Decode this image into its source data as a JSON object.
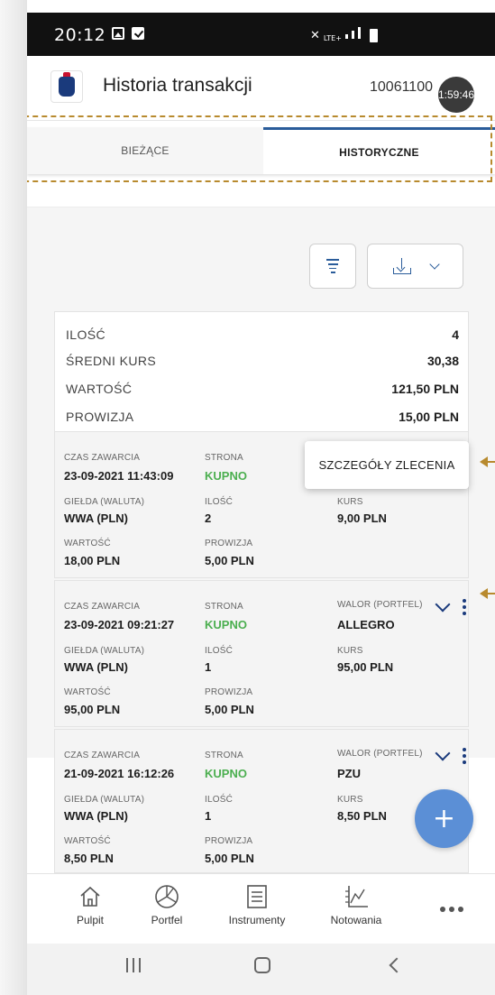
{
  "status_bar": {
    "time": "20:12",
    "network_label": "LTE+"
  },
  "app_bar": {
    "title": "Historia transakcji",
    "account_number": "10061100",
    "session_timer": "1:59:46"
  },
  "tabs": [
    {
      "label": "BIEŻĄCE",
      "active": false
    },
    {
      "label": "HISTORYCZNE",
      "active": true
    }
  ],
  "summary": {
    "rows": [
      {
        "label": "ILOŚĆ",
        "value": "4"
      },
      {
        "label": "ŚREDNI KURS",
        "value": "30,38"
      },
      {
        "label": "WARTOŚĆ",
        "value": "121,50 PLN"
      },
      {
        "label": "PROWIZJA",
        "value": "15,00 PLN"
      }
    ]
  },
  "field_labels": {
    "time": "CZAS ZAWARCIA",
    "side": "STRONA",
    "asset": "WALOR (PORTFEL)",
    "exchange": "GIEŁDA (WALUTA)",
    "quantity": "ILOŚĆ",
    "price": "KURS",
    "value": "WARTOŚĆ",
    "commission": "PROWIZJA"
  },
  "transactions": [
    {
      "time": "23-09-2021 11:43:09",
      "side": "KUPNO",
      "asset": "",
      "exchange": "WWA (PLN)",
      "quantity": "2",
      "price": "9,00 PLN",
      "value": "18,00 PLN",
      "commission": "5,00 PLN"
    },
    {
      "time": "23-09-2021 09:21:27",
      "side": "KUPNO",
      "asset": "ALLEGRO",
      "exchange": "WWA (PLN)",
      "quantity": "1",
      "price": "95,00 PLN",
      "value": "95,00 PLN",
      "commission": "5,00 PLN"
    },
    {
      "time": "21-09-2021 16:12:26",
      "side": "KUPNO",
      "asset": "PZU",
      "exchange": "WWA (PLN)",
      "quantity": "1",
      "price": "8,50 PLN",
      "value": "8,50 PLN",
      "commission": "5,00 PLN"
    }
  ],
  "popup_menu": {
    "item": "SZCZEGÓŁY ZLECENIA"
  },
  "fab": {
    "label": "+"
  },
  "bottom_nav": [
    {
      "label": "Pulpit",
      "icon": "home-icon"
    },
    {
      "label": "Portfel",
      "icon": "pie-chart-icon"
    },
    {
      "label": "Instrumenty",
      "icon": "list-document-icon"
    },
    {
      "label": "Notowania",
      "icon": "line-chart-icon"
    },
    {
      "label": "",
      "icon": "more-dots-icon"
    }
  ],
  "colors": {
    "accent": "#2a5c9a",
    "buy": "#4caf50",
    "fab": "#5b8fd6",
    "annotation": "#b88a2e"
  }
}
